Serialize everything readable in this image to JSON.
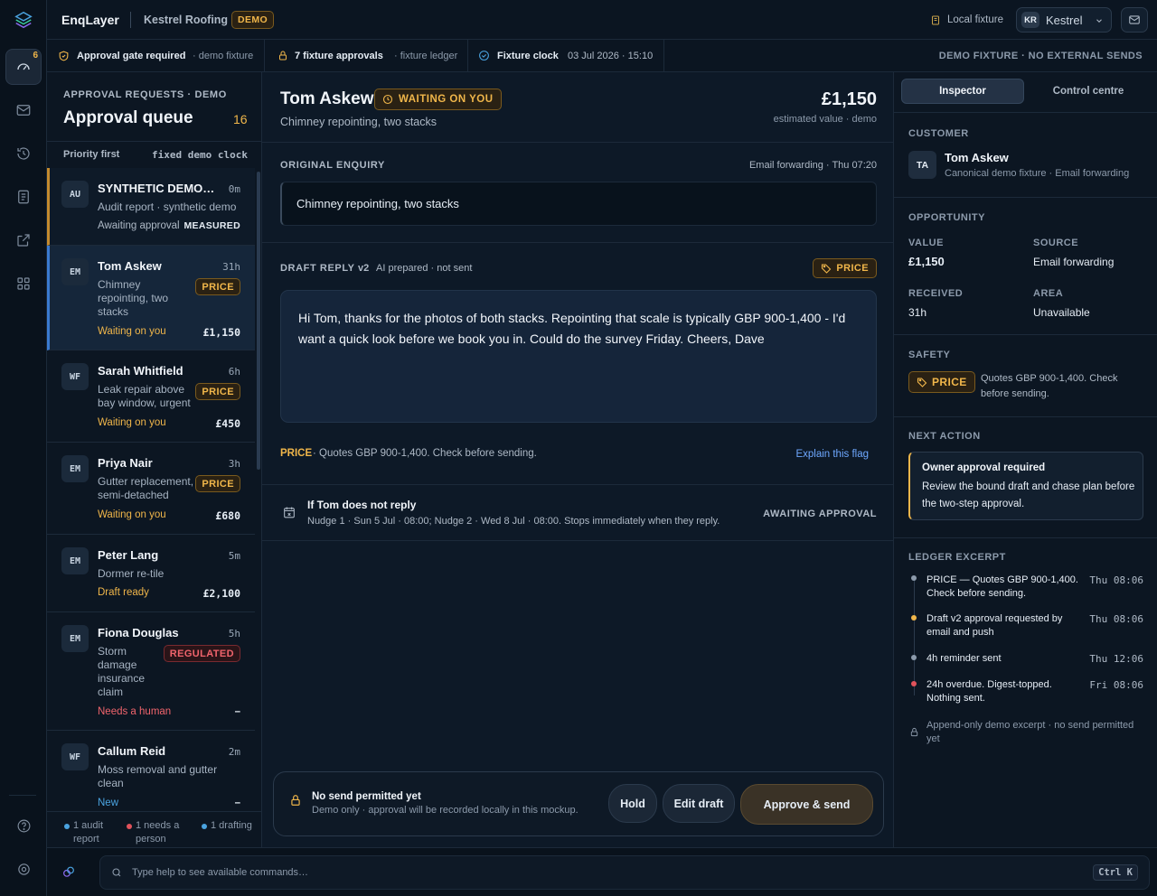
{
  "app": {
    "name": "EnqLayer",
    "workspace": "Kestrel Roofing",
    "demo_badge": "DEMO",
    "local_fixture": "Local fixture",
    "user_initials": "KR",
    "user_name": "Kestrel",
    "rail_badge": "6"
  },
  "status": {
    "gate_bold": "Approval gate required",
    "gate_note": "· demo fixture",
    "approvals_bold": "7 fixture approvals",
    "approvals_note": "· fixture ledger",
    "clock_bold": "Fixture clock",
    "clock_value": "03 Jul 2026 · 15:10",
    "right_notice": "DEMO FIXTURE · NO EXTERNAL SENDS"
  },
  "queue": {
    "eyebrow": "APPROVAL REQUESTS · DEMO",
    "title": "Approval queue",
    "count": "16",
    "sort_label": "Priority first",
    "clock_label": "fixed demo clock",
    "items": [
      {
        "initials": "AU",
        "name": "SYNTHETIC DEMO — Audit",
        "age": "0m",
        "desc": "Audit report · synthetic demo",
        "status": "Awaiting approval",
        "value": "MEASURED"
      },
      {
        "initials": "EM",
        "name": "Tom Askew",
        "age": "31h",
        "desc": "Chimney repointing, two stacks",
        "tag": "PRICE",
        "status": "Waiting on you",
        "value": "£1,150"
      },
      {
        "initials": "WF",
        "name": "Sarah Whitfield",
        "age": "6h",
        "desc": "Leak repair above bay window, urgent",
        "tag": "PRICE",
        "status": "Waiting on you",
        "value": "£450"
      },
      {
        "initials": "EM",
        "name": "Priya Nair",
        "age": "3h",
        "desc": "Gutter replacement, semi-detached",
        "tag": "PRICE",
        "status": "Waiting on you",
        "value": "£680"
      },
      {
        "initials": "EM",
        "name": "Peter Lang",
        "age": "5m",
        "desc": "Dormer re-tile",
        "status": "Draft ready",
        "value": "£2,100"
      },
      {
        "initials": "EM",
        "name": "Fiona Douglas",
        "age": "5h",
        "desc": "Storm damage insurance claim",
        "tag": "REGULATED",
        "status": "Needs a human",
        "value": "–"
      },
      {
        "initials": "WF",
        "name": "Callum Reid",
        "age": "2m",
        "desc": "Moss removal and gutter clean",
        "status": "New",
        "value": "–"
      }
    ],
    "footer": [
      {
        "text": "1 audit report",
        "color": "#4aa3e0"
      },
      {
        "text": "1 needs a person",
        "color": "#e0525b"
      },
      {
        "text": "1 drafting",
        "color": "#4aa3e0"
      }
    ]
  },
  "main": {
    "name": "Tom Askew",
    "waiting": "WAITING ON YOU",
    "subtitle": "Chimney repointing, two stacks",
    "value": "£1,150",
    "value_note": "estimated value · demo",
    "orig_label": "ORIGINAL ENQUIRY",
    "orig_meta": "Email forwarding · Thu 07:20",
    "orig_text": "Chimney repointing, two stacks",
    "draft_label": "DRAFT REPLY",
    "draft_ver": "v2",
    "draft_meta": "AI prepared · not sent",
    "draft_tag": "PRICE",
    "draft_text": "Hi Tom, thanks for the photos of both stacks. Repointing that scale is typically GBP 900-1,400 - I'd want a quick look before we book you in. Could do the survey Friday. Cheers, Dave",
    "flag_key": "PRICE",
    "flag_text": "· Quotes GBP 900-1,400. Check before sending.",
    "flag_link": "Explain this flag",
    "nudge_title": "If Tom does not reply",
    "nudge_text": "Nudge 1 · Sun 5 Jul · 08:00; Nudge 2 · Wed 8 Jul · 08:00. Stops immediately when they reply.",
    "nudge_status": "AWAITING APPROVAL",
    "send_title": "No send permitted yet",
    "send_note": "Demo only · approval will be recorded locally in this mockup.",
    "hold": "Hold",
    "edit": "Edit draft",
    "approve": "Approve & send"
  },
  "inspector": {
    "tab_active": "Inspector",
    "tab_other": "Control centre",
    "customer_label": "CUSTOMER",
    "cust_initials": "TA",
    "cust_name": "Tom Askew",
    "cust_note": "Canonical demo fixture · Email forwarding",
    "opp_label": "OPPORTUNITY",
    "value_label": "VALUE",
    "value": "£1,150",
    "source_label": "SOURCE",
    "source": "Email forwarding",
    "received_label": "RECEIVED",
    "received": "31h",
    "area_label": "AREA",
    "area": "Unavailable",
    "safety_label": "SAFETY",
    "safety_tag": "PRICE",
    "safety_text": "Quotes GBP 900-1,400. Check before sending.",
    "next_label": "NEXT ACTION",
    "next_title": "Owner approval required",
    "next_text": "Review the bound draft and chase plan before the two-step approval.",
    "ledger_label": "LEDGER EXCERPT",
    "ledger": [
      {
        "text": "PRICE — Quotes GBP 900-1,400. Check before sending.",
        "time": "Thu 08:06",
        "color": "#8c9aab"
      },
      {
        "text": "Draft v2 approval requested by email and push",
        "time": "Thu 08:06",
        "color": "#f0b64a"
      },
      {
        "text": "4h reminder sent",
        "time": "Thu 12:06",
        "color": "#8c9aab"
      },
      {
        "text": "24h overdue. Digest-topped. Nothing sent.",
        "time": "Fri 08:06",
        "color": "#e0525b"
      }
    ],
    "ledger_note": "Append-only demo excerpt · no send permitted yet"
  },
  "command": {
    "placeholder": "Type help to see available commands…",
    "shortcut": "Ctrl K"
  }
}
